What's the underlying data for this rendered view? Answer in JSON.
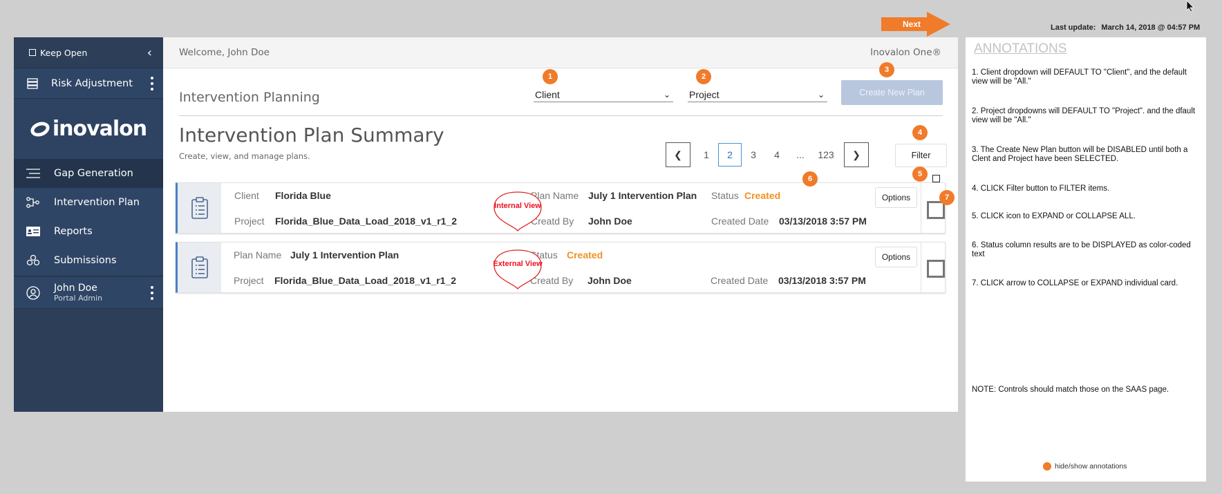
{
  "top": {
    "next_label": "Next",
    "last_update_label": "Last update:",
    "last_update_value": "March 14, 2018 @ 04:57 PM"
  },
  "sidebar": {
    "keep_open": "Keep Open",
    "risk_adjustment": "Risk Adjustment",
    "logo_text": "inovalon",
    "nav": [
      {
        "label": "Gap Generation",
        "icon": "list-icon"
      },
      {
        "label": "Intervention Plan",
        "icon": "workflow-icon"
      },
      {
        "label": "Reports",
        "icon": "id-card-icon"
      },
      {
        "label": "Submissions",
        "icon": "cubes-icon"
      }
    ],
    "user": {
      "name": "John Doe",
      "role": "Portal Admin"
    }
  },
  "header": {
    "welcome": "Welcome, John Doe",
    "brand": "Inovalon One®"
  },
  "planning": {
    "title": "Intervention Planning",
    "client_dropdown": "Client",
    "project_dropdown": "Project",
    "create_button": "Create New Plan"
  },
  "summary": {
    "title": "Intervention Plan Summary",
    "subtitle": "Create, view, and manage plans.",
    "filter_button": "Filter",
    "pager": {
      "pages": [
        "1",
        "2",
        "3",
        "4",
        "...",
        "123"
      ],
      "active": "2"
    }
  },
  "cards": [
    {
      "row1": [
        {
          "label": "Client",
          "value": "Florida Blue"
        },
        {
          "label": "Plan Name",
          "value": "July 1 Intervention Plan"
        },
        {
          "label": "Status",
          "value": "Created"
        }
      ],
      "row2": [
        {
          "label": "Project",
          "value": "Florida_Blue_Data_Load_2018_v1_r1_2"
        },
        {
          "label": "Creatd By",
          "value": "John Doe"
        },
        {
          "label": "Created Date",
          "value": "03/13/2018 3:57 PM"
        }
      ],
      "bubble": "Internal View",
      "options": "Options"
    },
    {
      "row1": [
        {
          "label": "Plan Name",
          "value": "July 1 Intervention Plan"
        },
        {
          "label": "Status",
          "value": "Created"
        }
      ],
      "row2": [
        {
          "label": "Project",
          "value": "Florida_Blue_Data_Load_2018_v1_r1_2"
        },
        {
          "label": "Creatd By",
          "value": "John Doe"
        },
        {
          "label": "Created Date",
          "value": "03/13/2018 3:57 PM"
        }
      ],
      "bubble": "External View",
      "options": "Options"
    }
  ],
  "badges": [
    "1",
    "2",
    "3",
    "4",
    "5",
    "6",
    "7"
  ],
  "annotations": {
    "title": "ANNOTATIONS",
    "notes": [
      "1.  Client dropdown will DEFAULT TO \"Client\", and the default view will be \"All.\"",
      "2.  Project dropdowns will DEFAULT TO  \"Project\". and the dfault view will be \"All.\"",
      "3.  The Create New Plan button will be DISABLED until both a Clent and Project have been SELECTED.",
      "4.  CLICK Filter button to FILTER items.",
      "5.  CLICK icon to EXPAND or COLLAPSE ALL.",
      "6.  Status column results are to be DISPLAYED as color-coded text",
      "7.  CLICK arrow to COLLAPSE or EXPAND individual card."
    ],
    "note_footer": "NOTE:  Controls should match those on the SAAS page.",
    "toggle": "hide/show annotations"
  },
  "colors": {
    "accent": "#f07b2a",
    "sidebar": "#2c3e58",
    "status": "#f0921f",
    "bubble": "#e12222"
  }
}
